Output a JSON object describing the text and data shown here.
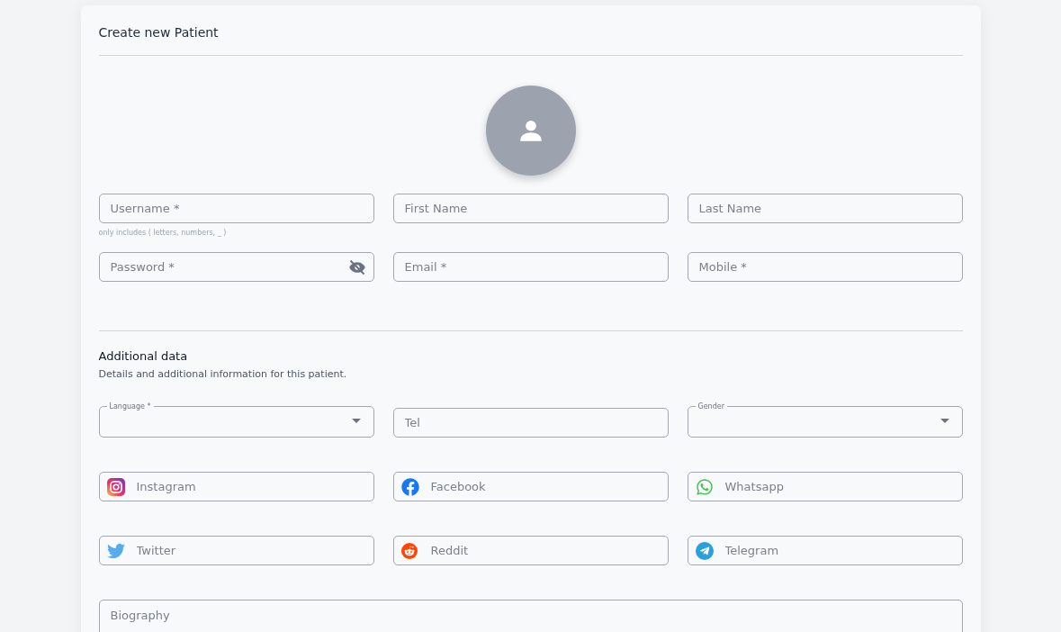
{
  "title": "Create new Patient",
  "account_fields": [
    {
      "placeholder": "Username *",
      "helper": "only includes ( letters, numbers, _ )"
    },
    {
      "placeholder": "First Name"
    },
    {
      "placeholder": "Last Name"
    },
    {
      "placeholder": "Password *",
      "password_hidden": true
    },
    {
      "placeholder": "Email *"
    },
    {
      "placeholder": "Mobile *"
    }
  ],
  "section": {
    "title": "Additional data",
    "description": "Details and additional information for this patient."
  },
  "detail_fields": [
    {
      "kind": "select",
      "label": "Language *"
    },
    {
      "kind": "text",
      "placeholder": "Tel"
    },
    {
      "kind": "select",
      "label": "Gender"
    }
  ],
  "social_fields": [
    {
      "kind": "instagram",
      "placeholder": "Instagram"
    },
    {
      "kind": "facebook",
      "placeholder": "Facebook"
    },
    {
      "kind": "whatsapp",
      "placeholder": "Whatsapp"
    },
    {
      "kind": "twitter",
      "placeholder": "Twitter"
    },
    {
      "kind": "reddit",
      "placeholder": "Reddit"
    },
    {
      "kind": "telegram",
      "placeholder": "Telegram"
    }
  ],
  "biography": {
    "placeholder": "Biography"
  }
}
